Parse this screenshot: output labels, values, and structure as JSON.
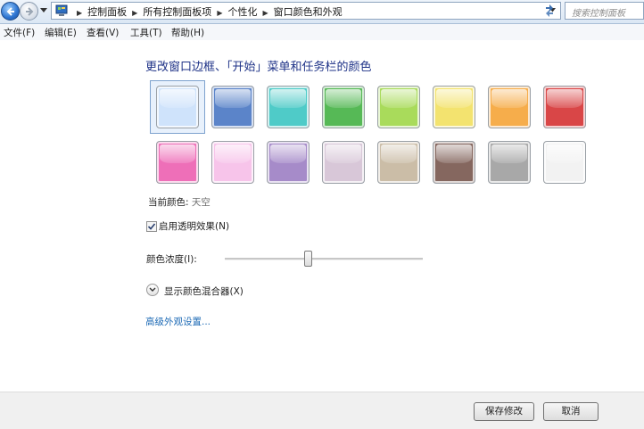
{
  "address_bar": {
    "crumbs": [
      "控制面板",
      "所有控制面板项",
      "个性化",
      "窗口颜色和外观"
    ],
    "search_placeholder": "搜索控制面板"
  },
  "menu": {
    "items": [
      "文件(F)",
      "编辑(E)",
      "查看(V)",
      "工具(T)",
      "帮助(H)"
    ]
  },
  "main": {
    "title": "更改窗口边框、「开始」菜单和任务栏的颜色",
    "swatches": [
      {
        "color": "#cfe3fb",
        "selected": true
      },
      {
        "color": "#5b84c9"
      },
      {
        "color": "#4fcbc8"
      },
      {
        "color": "#56b956"
      },
      {
        "color": "#a9db5b"
      },
      {
        "color": "#f3e36f"
      },
      {
        "color": "#f6ad4b"
      },
      {
        "color": "#d94647"
      },
      {
        "color": "#ee6fb8"
      },
      {
        "color": "#f7c4ea"
      },
      {
        "color": "#a68bc9"
      },
      {
        "color": "#d8c7d8"
      },
      {
        "color": "#cbbda7"
      },
      {
        "color": "#85675f"
      },
      {
        "color": "#a8a8a8"
      },
      {
        "color": "#f2f2f2"
      }
    ],
    "current_color_label": "当前颜色:",
    "current_color_value": "天空",
    "transparency_label": "启用透明效果(N)",
    "transparency_checked": true,
    "intensity_label": "颜色浓度(I):",
    "intensity_level": 0.42,
    "mixer_label": "显示颜色混合器(X)",
    "advanced_link": "高级外观设置..."
  },
  "buttons": {
    "save": "保存修改",
    "cancel": "取消"
  }
}
